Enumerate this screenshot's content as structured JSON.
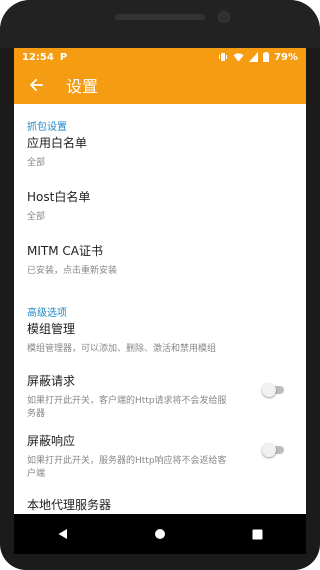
{
  "status_bar": {
    "time": "12:54",
    "notification_glyph": "P",
    "battery": "79%",
    "icons": [
      "p-app-icon",
      "vibrate-icon",
      "wifi-icon",
      "signal-icon",
      "battery-icon"
    ]
  },
  "app_bar": {
    "title": "设置",
    "back_icon": "arrow-left-icon"
  },
  "sections": [
    {
      "header": "抓包设置",
      "items": [
        {
          "title": "应用白名单",
          "summary": "全部"
        },
        {
          "title": "Host白名单",
          "summary": "全部"
        },
        {
          "title": "MITM CA证书",
          "summary": "已安装，点击重新安装"
        }
      ]
    },
    {
      "header": "高级选项",
      "items": [
        {
          "title": "模组管理",
          "summary": "模组管理器，可以添加、删除、激活和禁用模组"
        },
        {
          "title": "屏蔽请求",
          "summary": "如果打开此开关，客户端的Http请求将不会发给服务器",
          "toggle": false
        },
        {
          "title": "屏蔽响应",
          "summary": "如果打开此开关，服务器的Http响应将不会返给客户端",
          "toggle": false
        },
        {
          "title": "本地代理服务器",
          "summary": ""
        }
      ]
    }
  ],
  "nav_bar": {
    "icons": [
      "back-triangle-icon",
      "home-circle-icon",
      "recents-square-icon"
    ]
  },
  "colors": {
    "accent": "#f59c12",
    "section_header": "#1e88c9",
    "toggle_off_track": "#bdbdbd"
  }
}
